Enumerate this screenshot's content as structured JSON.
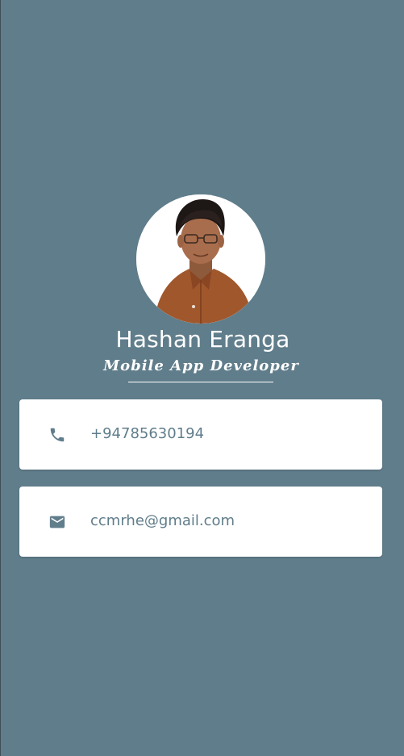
{
  "profile": {
    "name": "Hashan Eranga",
    "role": "Mobile App Developer",
    "avatar_icon": "profile-photo"
  },
  "contacts": {
    "phone": {
      "icon": "phone-icon",
      "value": "+94785630194"
    },
    "email": {
      "icon": "mail-icon",
      "value": "ccmrhe@gmail.com"
    }
  },
  "colors": {
    "background": "#607d8b",
    "card": "#ffffff",
    "accent_text": "#607d8b"
  }
}
